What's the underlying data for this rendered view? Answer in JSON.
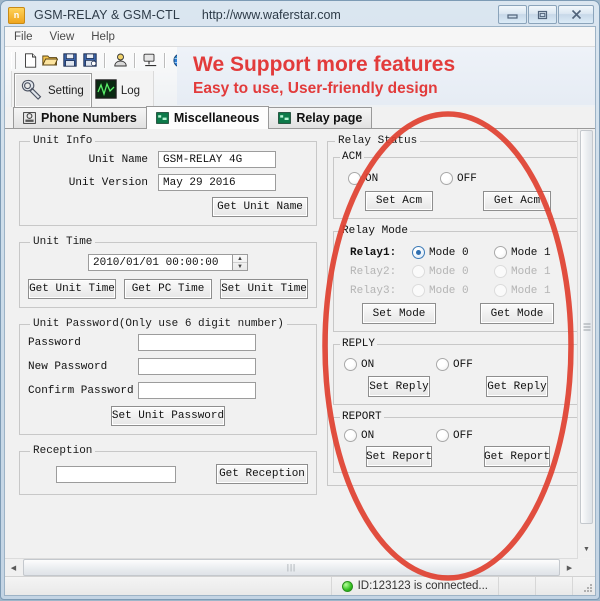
{
  "window": {
    "title": "GSM-RELAY & GSM-CTL",
    "url": "http://www.waferstar.com",
    "icon": "app-icon",
    "buttons": {
      "minimize": "minimize-button",
      "maximize": "maximize-button",
      "close": "close-button"
    }
  },
  "menu": {
    "items": [
      "File",
      "View",
      "Help"
    ]
  },
  "toolbar": {
    "small_icons": [
      "new-file-icon",
      "open-folder-icon",
      "save-icon",
      "save-as-icon",
      "user-icon",
      "connect-icon",
      "globe-icon"
    ],
    "buttons": [
      {
        "label": "Setting",
        "icon": "wrench-icon",
        "active": true
      },
      {
        "label": "Log",
        "icon": "chart-icon",
        "active": false
      }
    ]
  },
  "banner": {
    "line1": "We Support more features",
    "line2": "Easy to use, User-friendly design",
    "color": "#e23b3b"
  },
  "tabs": [
    {
      "label": "Phone Numbers",
      "icon": "phone-icon",
      "selected": false
    },
    {
      "label": "Miscellaneous",
      "icon": "misc-icon",
      "selected": true
    },
    {
      "label": "Relay page",
      "icon": "relay-icon",
      "selected": false
    }
  ],
  "left": {
    "unit_info": {
      "legend": "Unit Info",
      "name_label": "Unit Name",
      "name_value": "GSM-RELAY 4G",
      "version_label": "Unit Version",
      "version_value": "May 29 2016",
      "get_button": "Get Unit Name"
    },
    "unit_time": {
      "legend": "Unit Time",
      "value": "2010/01/01 00:00:00",
      "buttons": [
        "Get Unit Time",
        "Get PC Time",
        "Set Unit Time"
      ]
    },
    "unit_password": {
      "legend": "Unit Password(Only use 6 digit number)",
      "fields": [
        {
          "label": "Password",
          "value": ""
        },
        {
          "label": "New Password",
          "value": ""
        },
        {
          "label": "Confirm Password",
          "value": ""
        }
      ],
      "set_button": "Set Unit Password"
    },
    "reception": {
      "legend": "Reception",
      "value": "",
      "get_button": "Get Reception"
    }
  },
  "right": {
    "relay_status": {
      "legend": "Relay Status",
      "acm": {
        "legend": "ACM",
        "on_label": "ON",
        "off_label": "OFF",
        "on_selected": false,
        "off_selected": false,
        "set_button": "Set Acm",
        "get_button": "Get Acm"
      },
      "relay_mode": {
        "legend": "Relay Mode",
        "mode0_label": "Mode 0",
        "mode1_label": "Mode 1",
        "rows": [
          {
            "name": "Relay1:",
            "enabled": true,
            "selected": "mode0"
          },
          {
            "name": "Relay2:",
            "enabled": false,
            "selected": ""
          },
          {
            "name": "Relay3:",
            "enabled": false,
            "selected": ""
          }
        ],
        "set_button": "Set Mode",
        "get_button": "Get Mode"
      },
      "reply": {
        "legend": "REPLY",
        "on_label": "ON",
        "off_label": "OFF",
        "on_selected": false,
        "off_selected": false,
        "set_button": "Set Reply",
        "get_button": "Get Reply"
      },
      "report": {
        "legend": "REPORT",
        "on_label": "ON",
        "off_label": "OFF",
        "on_selected": false,
        "off_selected": false,
        "set_button": "Set Report",
        "get_button": "Get Report"
      }
    }
  },
  "statusbar": {
    "message": "ID:123123 is connected...",
    "led_color": "#33c221"
  },
  "annotation": {
    "shape": "ellipse",
    "color": "#e04030"
  }
}
